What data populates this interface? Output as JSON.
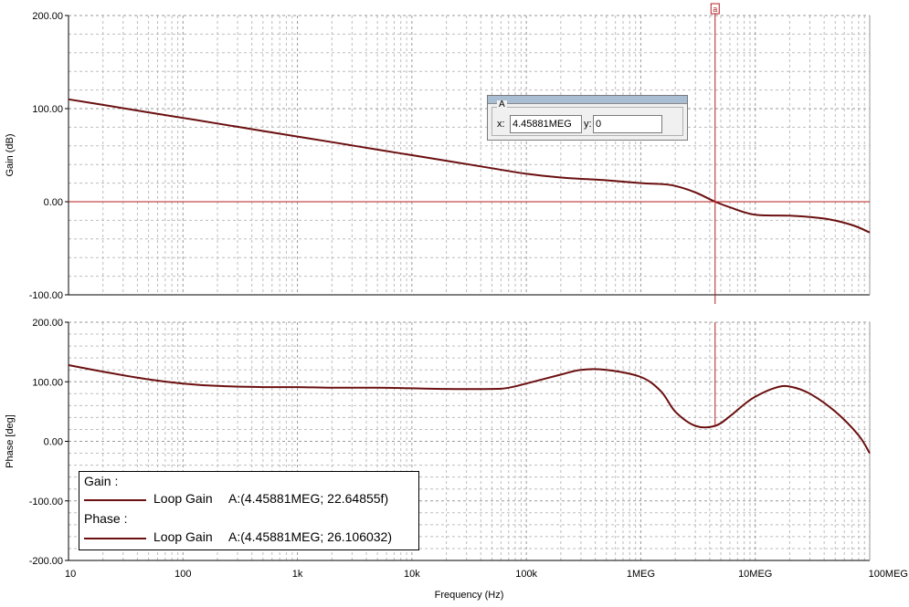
{
  "colors": {
    "trace": "#6b0f10",
    "cursor": "#b41e22",
    "grid": "#bdbdbd"
  },
  "chart_data": [
    {
      "type": "line",
      "ylabel": "Gain (dB)",
      "xlabel": "",
      "xscale": "log",
      "xlim": [
        10,
        100000000
      ],
      "ylim": [
        -100,
        200
      ],
      "yticks": [
        {
          "value": 200,
          "label": "200.00"
        },
        {
          "value": 100,
          "label": "100.00"
        },
        {
          "value": 0,
          "label": "0.00"
        },
        {
          "value": -100,
          "label": "-100.00"
        }
      ],
      "grid": true,
      "series": [
        {
          "name": "Loop Gain",
          "x": [
            10,
            20,
            50,
            100,
            200,
            500,
            1000,
            2000,
            5000,
            10000,
            20000,
            50000,
            100000,
            200000,
            500000,
            1000000,
            1500000,
            2000000,
            3000000,
            4458810,
            6000000,
            10000000,
            20000000,
            40000000,
            70000000,
            100000000
          ],
          "y": [
            110,
            104,
            96,
            90,
            84,
            76,
            70,
            64,
            56,
            50,
            44,
            36,
            30,
            26,
            23,
            20,
            19,
            17,
            10,
            0,
            -6,
            -14,
            -15,
            -18,
            -25,
            -33
          ]
        }
      ]
    },
    {
      "type": "line",
      "ylabel": "Phase [deg]",
      "xlabel": "Frequency (Hz)",
      "xscale": "log",
      "xlim": [
        10,
        100000000
      ],
      "ylim": [
        -200,
        200
      ],
      "yticks": [
        {
          "value": 200,
          "label": "200.00"
        },
        {
          "value": 100,
          "label": "100.00"
        },
        {
          "value": 0,
          "label": "0.00"
        },
        {
          "value": -100,
          "label": "-100.00"
        },
        {
          "value": -200,
          "label": "-200.00"
        }
      ],
      "xticks": [
        {
          "value": 10,
          "label": "10"
        },
        {
          "value": 100,
          "label": "100"
        },
        {
          "value": 1000,
          "label": "1k"
        },
        {
          "value": 10000,
          "label": "10k"
        },
        {
          "value": 100000,
          "label": "100k"
        },
        {
          "value": 1000000,
          "label": "1MEG"
        },
        {
          "value": 10000000,
          "label": "10MEG"
        },
        {
          "value": 100000000,
          "label": "100MEG"
        }
      ],
      "grid": true,
      "series": [
        {
          "name": "Loop Gain",
          "x": [
            10,
            20,
            50,
            100,
            200,
            500,
            1000,
            2000,
            5000,
            10000,
            20000,
            50000,
            70000,
            100000,
            200000,
            300000,
            500000,
            1000000,
            1500000,
            2000000,
            3000000,
            4458810,
            6000000,
            8000000,
            10000000,
            15000000,
            20000000,
            30000000,
            50000000,
            80000000,
            100000000
          ],
          "y": [
            128,
            117,
            104,
            97,
            93,
            91,
            91,
            90,
            90,
            89,
            88,
            88,
            90,
            97,
            112,
            120,
            120,
            108,
            84,
            50,
            26,
            26,
            42,
            62,
            75,
            90,
            92,
            80,
            50,
            10,
            -20
          ]
        }
      ]
    }
  ],
  "cursor": {
    "marker": "a",
    "x_value": 4458810,
    "y_value": 0,
    "box_title": "A",
    "x_label": "x:",
    "x_text": "4.45881MEG",
    "y_label": "y:",
    "y_text": "0"
  },
  "legend": {
    "gain_title": "Gain :",
    "gain_series": "Loop Gain",
    "gain_value": "A:(4.45881MEG; 22.64855f)",
    "phase_title": "Phase :",
    "phase_series": "Loop Gain",
    "phase_value": "A:(4.45881MEG; 26.106032)"
  }
}
